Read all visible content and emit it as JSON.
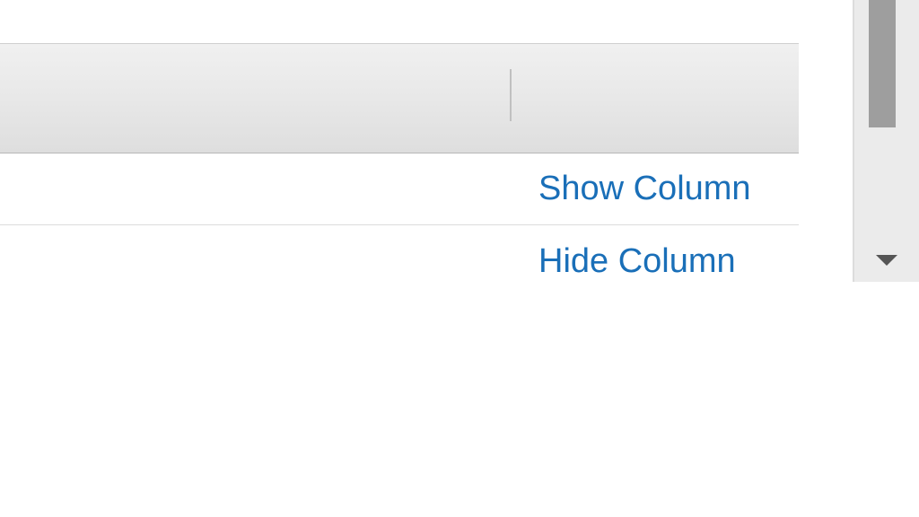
{
  "menu": {
    "items": [
      {
        "label": "Show Column"
      },
      {
        "label": "Hide Column"
      }
    ]
  }
}
